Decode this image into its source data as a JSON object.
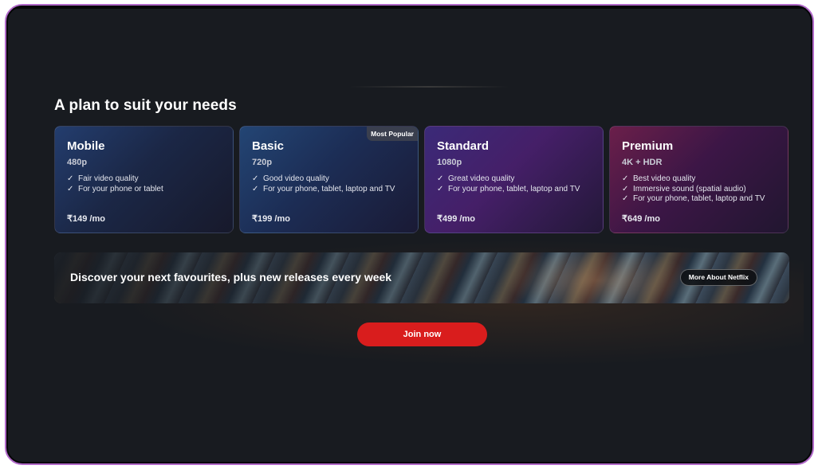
{
  "section": {
    "title": "A plan to suit your needs"
  },
  "plans": [
    {
      "name": "Mobile",
      "resolution": "480p",
      "features": [
        "Fair video quality",
        "For your phone or tablet"
      ],
      "price": "₹149 /mo",
      "badge": ""
    },
    {
      "name": "Basic",
      "resolution": "720p",
      "features": [
        "Good video quality",
        "For your phone, tablet, laptop and TV"
      ],
      "price": "₹199 /mo",
      "badge": "Most Popular"
    },
    {
      "name": "Standard",
      "resolution": "1080p",
      "features": [
        "Great video quality",
        "For your phone, tablet, laptop and TV"
      ],
      "price": "₹499 /mo",
      "badge": ""
    },
    {
      "name": "Premium",
      "resolution": "4K + HDR",
      "features": [
        "Best video quality",
        "Immersive sound (spatial audio)",
        "For your phone, tablet, laptop and TV"
      ],
      "price": "₹649 /mo",
      "badge": ""
    }
  ],
  "banner": {
    "text": "Discover your next favourites, plus new releases every week",
    "button_label": "More About Netflix"
  },
  "cta": {
    "join_label": "Join now"
  },
  "colors": {
    "background": "#181b20",
    "accent_red": "#d91d1d",
    "frame_border": "#b169c9"
  },
  "icons": {
    "feature_check": "check-icon"
  }
}
